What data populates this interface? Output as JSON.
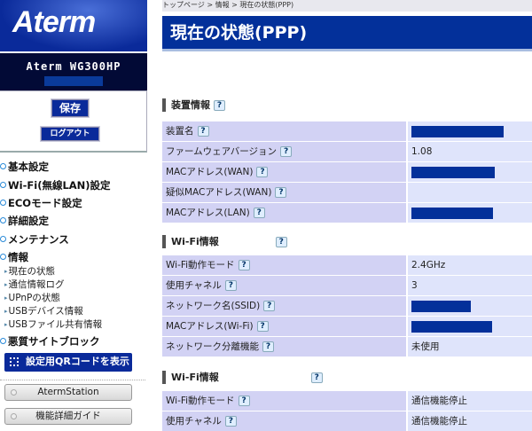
{
  "sidebar": {
    "logo": "Aterm",
    "model": "Aterm WG300HP",
    "save": "保存",
    "logout": "ログアウト",
    "nav": [
      "基本設定",
      "Wi-Fi(無線LAN)設定",
      "ECOモード設定",
      "詳細設定",
      "メンテナンス",
      "情報"
    ],
    "sub": [
      "現在の状態",
      "通信情報ログ",
      "UPnPの状態",
      "USBデバイス情報",
      "USBファイル共有情報"
    ],
    "block": "悪質サイトブロック",
    "qr": "設定用QRコードを表示",
    "station": "AtermStation",
    "guide": "機能詳細ガイド"
  },
  "breadcrumb": "トップページ > 情報 > 現在の状態(PPP)",
  "title": "現在の状態(PPP)",
  "help": "?",
  "sections": [
    {
      "title": "装置情報",
      "rows": [
        {
          "label": "装置名",
          "value": null
        },
        {
          "label": "ファームウェアバージョン",
          "value": "1.08"
        },
        {
          "label": "MACアドレス(WAN)",
          "value": null
        },
        {
          "label": "疑似MACアドレス(WAN)",
          "value": ""
        },
        {
          "label": "MACアドレス(LAN)",
          "value": null
        }
      ]
    },
    {
      "title": "Wi-Fi情報",
      "rows": [
        {
          "label": "Wi-Fi動作モード",
          "value": "2.4GHz"
        },
        {
          "label": "使用チャネル",
          "value": "3"
        },
        {
          "label": "ネットワーク名(SSID)",
          "value": null
        },
        {
          "label": "MACアドレス(Wi-Fi)",
          "value": null
        },
        {
          "label": "ネットワーク分離機能",
          "value": "未使用"
        }
      ]
    },
    {
      "title": "Wi-Fi情報",
      "rows": [
        {
          "label": "Wi-Fi動作モード",
          "value": "通信機能停止"
        },
        {
          "label": "使用チャネル",
          "value": "通信機能停止"
        }
      ]
    }
  ],
  "colors": {
    "brand": "#03309a",
    "label_bg": "#d2d2f4",
    "value_bg": "#dfe4fb"
  }
}
